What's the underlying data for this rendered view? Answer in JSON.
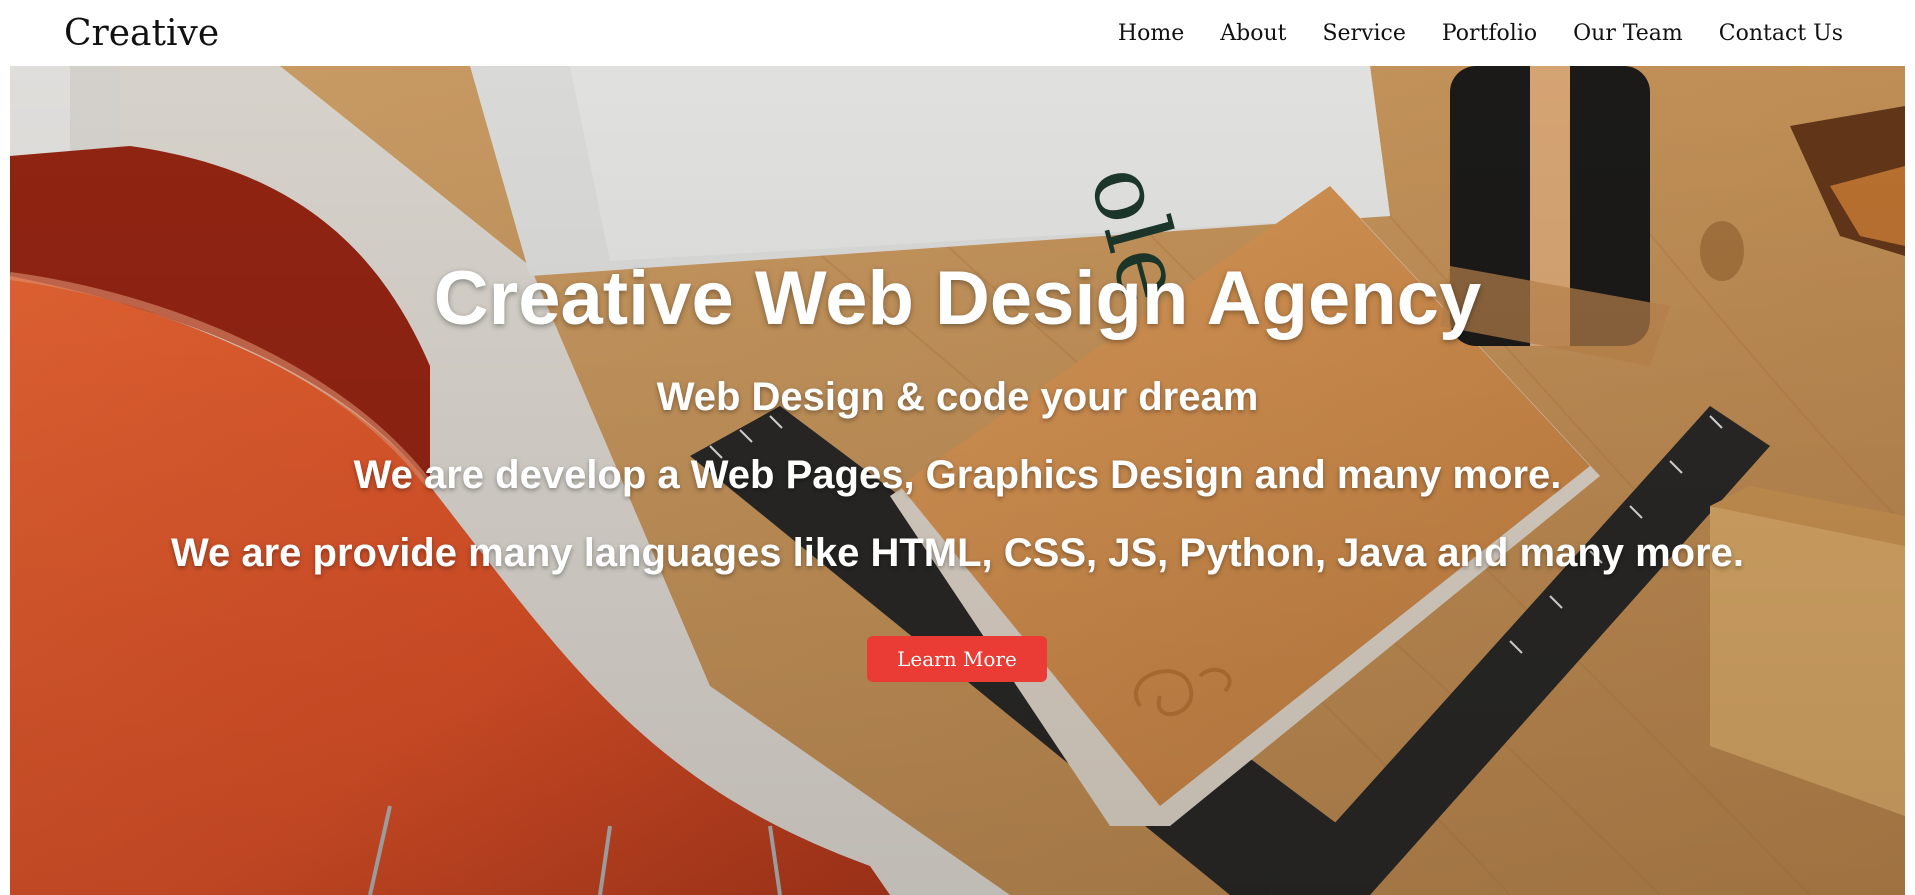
{
  "brand": "Creative",
  "nav": {
    "items": [
      {
        "label": "Home"
      },
      {
        "label": "About"
      },
      {
        "label": "Service"
      },
      {
        "label": "Portfolio"
      },
      {
        "label": "Our Team"
      },
      {
        "label": "Contact Us"
      }
    ]
  },
  "hero": {
    "title": "Creative Web Design Agency",
    "subtitle": "Web Design & code your dream",
    "line1": "We are develop a Web Pages, Graphics Design and many more.",
    "line2": "We are provide many languages like HTML, CSS, JS, Python, Java and many more.",
    "button_label": "Learn More"
  },
  "colors": {
    "button": "#ea3b35",
    "hero_text": "#ffffff",
    "nav_background": "#ffffff"
  }
}
